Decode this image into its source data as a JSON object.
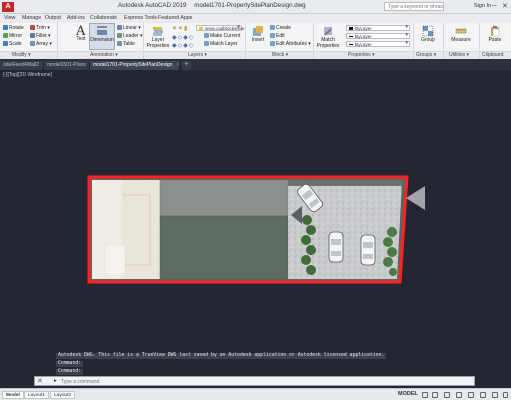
{
  "app": {
    "title": "Autodesk AutoCAD 2019",
    "file": "model1701-PropertySitePlanDesign.dwg",
    "search_placeholder": "Type a keyword or phrase",
    "signin": "Sign In",
    "logo": "A"
  },
  "menu": [
    "View",
    "Manage",
    "Output",
    "Add-ins",
    "Collaborate",
    "Express Tools",
    "Featured Apps"
  ],
  "ribbon": {
    "modify": {
      "title": "Modify ▾",
      "items": [
        "Rotate",
        "Trim ▾",
        "Mirror",
        "Fillet ▾",
        "Scale",
        "Array ▾"
      ]
    },
    "annotation": {
      "title": "Annotation ▾",
      "text": "Text",
      "dimension": "Dimension",
      "items": [
        "Linear ▾",
        "Leader ▾",
        "Table"
      ]
    },
    "layers": {
      "title": "Layers ▾",
      "properties": "Layer Properties",
      "current_layer": "www.cadblocksfree",
      "items": [
        "Make Current",
        "Match Layer"
      ]
    },
    "block": {
      "title": "Block ▾",
      "insert": "Insert",
      "items": [
        "Create",
        "Edit",
        "Edit Attributes ▾"
      ]
    },
    "properties": {
      "title": "Properties ▾",
      "match": "Match Properties",
      "dropdowns": [
        "ByLayer",
        "ByLayer",
        "ByLayer"
      ]
    },
    "groups": {
      "title": "Groups ▾",
      "group": "Group"
    },
    "utilities": {
      "title": "Utilities ▾",
      "measure": "Measure"
    },
    "clipboard": {
      "title": "Clipboard",
      "paste": "Paste"
    }
  },
  "doctabs": [
    {
      "label": "odelFeed4Wall2",
      "active": false
    },
    {
      "label": "model1501-Plans",
      "active": false
    },
    {
      "label": "model1701-PropertySitePlanDesign",
      "active": true
    }
  ],
  "canvas": {
    "view_label": "[-][Top][2D Wireframe]"
  },
  "command": {
    "history": [
      "Autodesk DWG.  This file is a TrueView DWG last saved by an Autodesk application or Autodesk licensed application.",
      "Command:",
      "Command:"
    ],
    "prompt": "▸",
    "placeholder": "Type a command"
  },
  "status": {
    "tabs": [
      "Model",
      "Layout1",
      "Layout2"
    ],
    "model_button": "MODEL"
  },
  "colors": {
    "canvas_bg": "#222733",
    "boundary": "#ff2222",
    "ribbon_bg": "#f3f4f6"
  }
}
